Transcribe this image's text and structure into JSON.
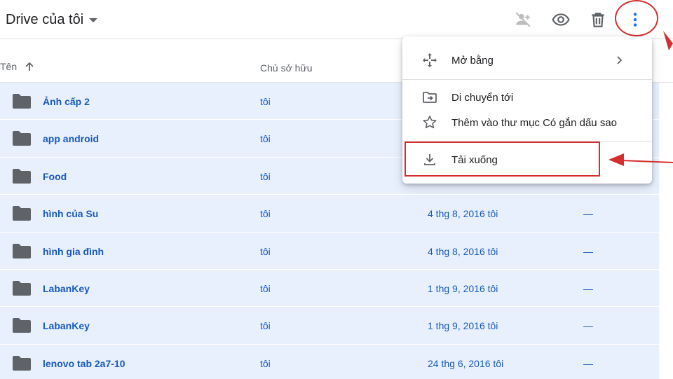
{
  "header": {
    "title": "Drive của tôi",
    "icons": [
      "share-off-icon",
      "preview-eye-icon",
      "trash-icon",
      "more-vert-icon"
    ]
  },
  "columns": {
    "name": "Tên",
    "owner": "Chủ sở hữu"
  },
  "rows": [
    {
      "name": "Ảnh cấp 2",
      "owner": "tôi",
      "modified": "",
      "size": ""
    },
    {
      "name": "app android",
      "owner": "tôi",
      "modified": "",
      "size": ""
    },
    {
      "name": "Food",
      "owner": "tôi",
      "modified": "",
      "size": ""
    },
    {
      "name": "hình của Su",
      "owner": "tôi",
      "modified": "4 thg 8, 2016 tôi",
      "size": "—"
    },
    {
      "name": "hình gia đình",
      "owner": "tôi",
      "modified": "4 thg 8, 2016 tôi",
      "size": "—"
    },
    {
      "name": "LabanKey",
      "owner": "tôi",
      "modified": "1 thg 9, 2016 tôi",
      "size": "—"
    },
    {
      "name": "LabanKey",
      "owner": "tôi",
      "modified": "1 thg 9, 2016 tôi",
      "size": "—"
    },
    {
      "name": "lenovo tab 2a7-10",
      "owner": "tôi",
      "modified": "24 thg 6, 2016 tôi",
      "size": "—"
    }
  ],
  "menu": {
    "open_with": "Mở bằng",
    "move_to": "Di chuyển tới",
    "add_starred": "Thêm vào thư mục Có gắn dấu sao",
    "download": "Tải xuống"
  },
  "colors": {
    "selected_row": "#e8f0fe",
    "selected_text": "#185abc",
    "annotation_red": "#d32f2f"
  }
}
